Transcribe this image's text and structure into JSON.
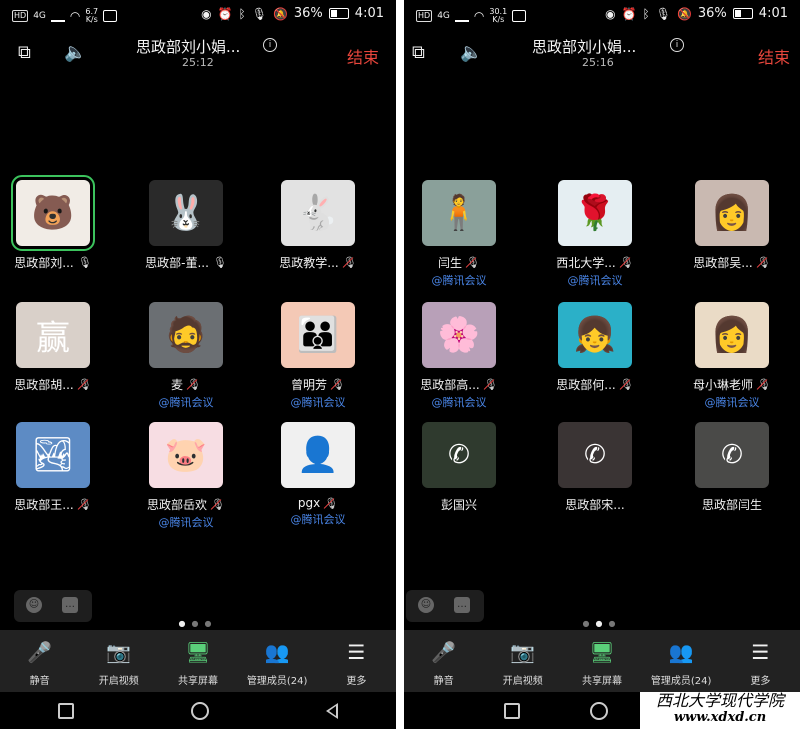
{
  "phones": [
    {
      "status": {
        "net": "4G",
        "speed": "6.7\nK/s",
        "battery": "36%",
        "time": "4:01"
      },
      "header": {
        "title": "思政部刘小娟...",
        "timer": "25:12",
        "end_label": "结束"
      },
      "participants": [
        {
          "name": "思政部刘...",
          "mic": "on",
          "via": "",
          "speaking": true,
          "color": "#f1ece6",
          "glyph": "🐻"
        },
        {
          "name": "思政部-董...",
          "mic": "on",
          "via": "",
          "color": "#2a2a2a",
          "glyph": "🐰"
        },
        {
          "name": "思政教学...",
          "mic": "off",
          "via": "",
          "color": "#e2e2e2",
          "glyph": "🐇"
        },
        {
          "name": "思政部胡...",
          "mic": "off",
          "via": "",
          "color": "#d9d0c9",
          "glyph": "赢"
        },
        {
          "name": "麦",
          "mic": "off",
          "via": "@腾讯会议",
          "color": "#6b6f73",
          "glyph": "🧔"
        },
        {
          "name": "曾明芳",
          "mic": "off",
          "via": "@腾讯会议",
          "color": "#f4c9b6",
          "glyph": "👪"
        },
        {
          "name": "思政部王...",
          "mic": "off",
          "via": "",
          "color": "#5d8bc4",
          "glyph": "🏞"
        },
        {
          "name": "思政部岳欢",
          "mic": "off",
          "via": "@腾讯会议",
          "color": "#f7dde3",
          "glyph": "🐷"
        },
        {
          "name": "pgx",
          "mic": "off",
          "via": "@腾讯会议",
          "color": "#f0f0f0",
          "glyph": "👤"
        }
      ],
      "page_dots": [
        true,
        false,
        false
      ],
      "toolbar": [
        "静音",
        "开启视频",
        "共享屏幕",
        "管理成员(24)",
        "更多"
      ]
    },
    {
      "status": {
        "net": "4G",
        "speed": "30.1\nK/s",
        "battery": "36%",
        "time": "4:01"
      },
      "header": {
        "title": "思政部刘小娟...",
        "timer": "25:16",
        "end_label": "结束"
      },
      "participants": [
        {
          "name": "闫生",
          "mic": "off",
          "via": "@腾讯会议",
          "color": "#8aa09a",
          "glyph": "🧍"
        },
        {
          "name": "西北大学...",
          "mic": "off",
          "via": "@腾讯会议",
          "color": "#e5eef2",
          "glyph": "🌹"
        },
        {
          "name": "思政部吴...",
          "mic": "off",
          "via": "",
          "color": "#c9b9b1",
          "glyph": "👩"
        },
        {
          "name": "思政部高...",
          "mic": "off",
          "via": "@腾讯会议",
          "color": "#b8a0b8",
          "glyph": "🌸"
        },
        {
          "name": "思政部何...",
          "mic": "off",
          "via": "",
          "color": "#2bb0c8",
          "glyph": "👧"
        },
        {
          "name": "母小琳老师",
          "mic": "off",
          "via": "@腾讯会议",
          "color": "#eadbc6",
          "glyph": "👩"
        },
        {
          "name": "彭国兴",
          "mic": "",
          "via": "",
          "color": "#2f3a2e",
          "glyph": "📞",
          "phone": true
        },
        {
          "name": "思政部宋...",
          "mic": "",
          "via": "",
          "color": "#3a3434",
          "glyph": "📞",
          "phone": true
        },
        {
          "name": "思政部闫生",
          "mic": "",
          "via": "",
          "color": "#4a4a48",
          "glyph": "📞",
          "phone": true
        }
      ],
      "page_dots": [
        false,
        true,
        false
      ],
      "toolbar": [
        "静音",
        "开启视频",
        "共享屏幕",
        "管理成员(24)",
        "更多"
      ]
    }
  ],
  "watermark": {
    "line1": "西北大学现代学院",
    "line2": "www.xdxd.cn"
  },
  "colors": {
    "accent_red": "#e8463c",
    "link_blue": "#4a86e8",
    "speaking_green": "#3cc35d"
  }
}
